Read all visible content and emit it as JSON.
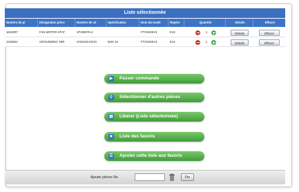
{
  "title": "Liste sélectionnée",
  "columns": [
    "Numéro de pi",
    "Désignation pièce",
    "Numéro de sé",
    "Spécification",
    "Nom du modè",
    "Repère",
    "Quantité",
    "Détails",
    "Effacer"
  ],
  "rows": [
    {
      "part_no": "1612097",
      "designation": "FAN MOTOR STAT",
      "serial": "1P108376-4",
      "spec": "",
      "model": "FTXS20KV1",
      "ref": "E13",
      "qty": "1",
      "details": "Détails",
      "delete": "Effacer"
    },
    {
      "part_no": "121650J",
      "designation": "GROUNDING TER",
      "serial": "HAW115-04/10",
      "spec": "M4X 16",
      "model": "FTXS20KV1",
      "ref": "E14",
      "qty": "1",
      "details": "Détails",
      "delete": "Effacer"
    }
  ],
  "actions": [
    {
      "label": "Passer commande",
      "icon": "arrow-right-icon"
    },
    {
      "label": "Sélectionner d'autres pièces",
      "icon": "search-icon"
    },
    {
      "label": "Libérer (Liste sélectionnée)",
      "icon": "print-icon"
    },
    {
      "label": "Liste des favoris",
      "icon": "star-icon"
    },
    {
      "label": "Ajouter cette liste aux favoris",
      "icon": "list-icon"
    }
  ],
  "bottom": {
    "label": "Ajouter pièces No.",
    "input_value": "",
    "ok_label": "Fin"
  }
}
